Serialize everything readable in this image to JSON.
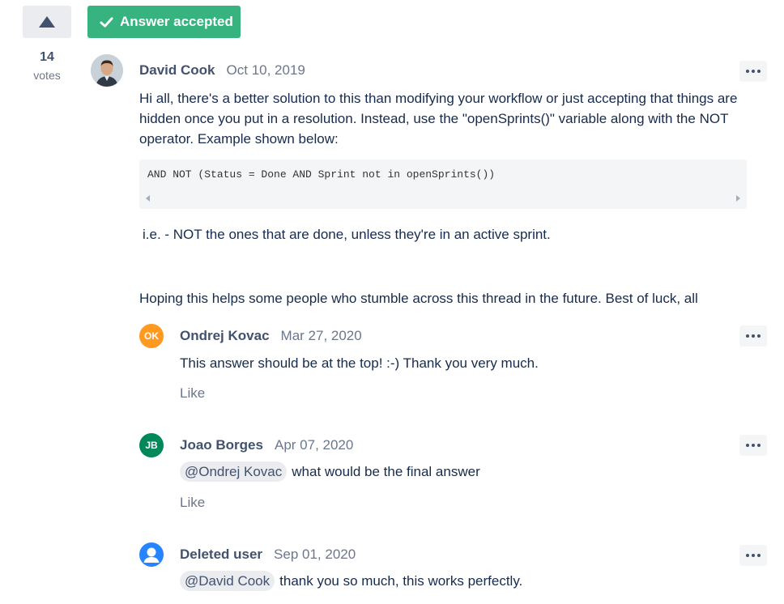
{
  "votes": {
    "count": "14",
    "label": "votes"
  },
  "accepted": {
    "label": "Answer accepted"
  },
  "answer": {
    "author": "David Cook",
    "date": "Oct 10, 2019",
    "paragraph1": "Hi all, there's a better solution to this than modifying your workflow or just accepting that things are hidden once you put in a resolution. Instead, use the \"openSprints()\" variable along with the NOT operator. Example shown below:",
    "code": "AND NOT (Status = Done AND Sprint not in openSprints())",
    "paragraph2": "i.e. - NOT the ones that are done, unless they're in an active sprint.",
    "paragraph3": "Hoping this helps some people who stumble across this thread in the future. Best of luck, all"
  },
  "comments": [
    {
      "initials": "OK",
      "author": "Ondrej Kovac",
      "date": "Mar 27, 2020",
      "mention": "",
      "text": "This answer should be at the top! :-) Thank you very much.",
      "like": "Like",
      "avatar_color": "#ff991f"
    },
    {
      "initials": "JB",
      "author": "Joao Borges",
      "date": "Apr 07, 2020",
      "mention": "@Ondrej Kovac",
      "text": "what would be the final answer",
      "like": "Like",
      "avatar_color": "#00875a"
    },
    {
      "initials": "",
      "author": "Deleted user",
      "date": "Sep 01, 2020",
      "mention": "@David Cook",
      "text": "thank you so much, this works perfectly.",
      "like": "",
      "avatar_color": "#2684ff"
    }
  ],
  "colors": {
    "accent_green": "#36b37e",
    "text": "#172b4d",
    "muted": "#6b778c"
  },
  "icons": {
    "vote": "triangle-up-icon",
    "check": "check-icon",
    "more": "more-icon"
  }
}
